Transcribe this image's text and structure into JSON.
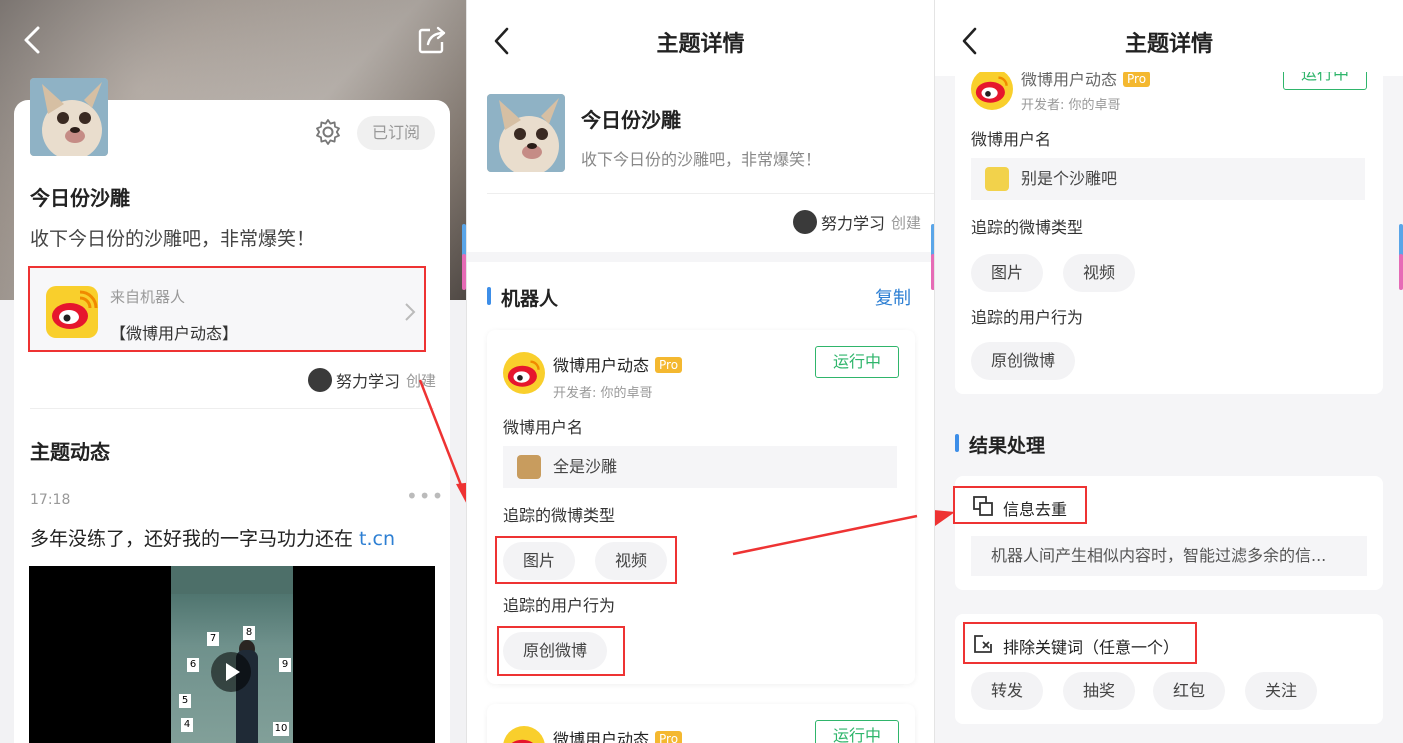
{
  "screen1": {
    "topic_title": "今日份沙雕",
    "topic_desc": "收下今日份的沙雕吧，非常爆笑！",
    "subscribe_label": "已订阅",
    "robot_from": "来自机器人",
    "robot_name": "【微博用户动态】",
    "creator_name": "努力学习",
    "creator_suffix": "创建",
    "section_title": "主题动态",
    "post_time": "17:18",
    "post_text": "多年没练了，还好我的一字马功力还在",
    "post_link": "t.cn",
    "video_numbers": [
      "7",
      "8",
      "6",
      "9",
      "5",
      "4",
      "10"
    ]
  },
  "screen2": {
    "header_title": "主题详情",
    "topic_title": "今日份沙雕",
    "topic_desc": "收下今日份的沙雕吧，非常爆笑！",
    "creator_name": "努力学习",
    "creator_suffix": "创建",
    "section_title": "机器人",
    "copy_label": "复制",
    "robot_card": {
      "name": "微博用户动态",
      "pro": "Pro",
      "developer": "开发者: 你的卓哥",
      "status": "运行中",
      "field1_label": "微博用户名",
      "field1_value": "全是沙雕",
      "field2_label": "追踪的微博类型",
      "field2_chips": [
        "图片",
        "视频"
      ],
      "field3_label": "追踪的用户行为",
      "field3_chips": [
        "原创微博"
      ]
    },
    "robot_card2": {
      "name": "微博用户动态",
      "pro": "Pro",
      "status": "运行中"
    }
  },
  "screen3": {
    "header_title": "主题详情",
    "robot_name": "微博用户动态",
    "pro": "Pro",
    "developer": "开发者: 你的卓哥",
    "status": "运行中",
    "field1_label": "微博用户名",
    "field1_value": "别是个沙雕吧",
    "field2_label": "追踪的微博类型",
    "field2_chips": [
      "图片",
      "视频"
    ],
    "field3_label": "追踪的用户行为",
    "field3_chips": [
      "原创微博"
    ],
    "section_title": "结果处理",
    "dedup_title": "信息去重",
    "dedup_desc": "机器人间产生相似内容时，智能过滤多余的信...",
    "exclude_title": "排除关键词（任意一个）",
    "exclude_chips": [
      "转发",
      "抽奖",
      "红包",
      "关注"
    ]
  },
  "colors": {
    "highlight_red": "#e33333",
    "running_green": "#2fb56b",
    "link_blue": "#2d7fd3",
    "pro_gold": "#f4b830",
    "section_bar_blue": "#3d8ee8"
  }
}
